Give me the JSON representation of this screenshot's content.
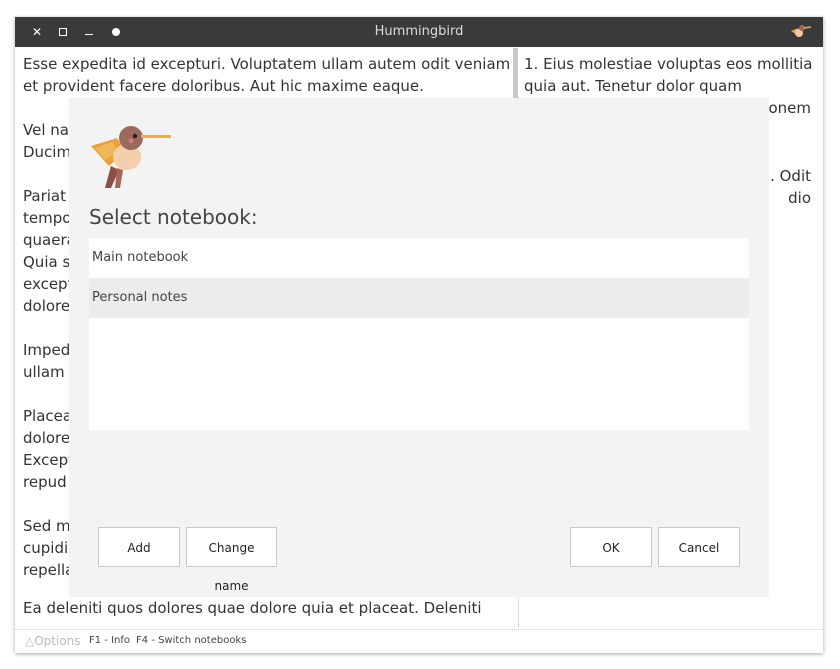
{
  "window": {
    "title": "Hummingbird",
    "controls": [
      "close-icon",
      "maximize-icon",
      "minimize-icon",
      "dot-icon"
    ]
  },
  "editor": {
    "left_paragraphs": [
      "Esse expedita id excepturi. Voluptatem ullam autem odit veniam et provident facere doloribus. Aut hic maxime eaque.",
      "Vel na\nDucim",
      "Pariat\ntempo\nquaera\nQuia s\nexcept\ndolore",
      "Imped\nullam",
      "Placea\ndolore\nExcept\nrepud",
      "Sed m\ncupidi\nrepella"
    ],
    "left_bottom_line": "Ea deleniti quos dolores quae dolore quia et placeat. Deleniti",
    "right_paragraphs": [
      "1. Eius molestiae voluptas eos mollitia quia aut. Tenetur dolor quam",
      "onem",
      ". Odit\ndio"
    ]
  },
  "statusbar": {
    "options": "△Options",
    "hint_f1": "F1 - Info",
    "hint_f4": "F4 - Switch notebooks"
  },
  "dialog": {
    "logo": "hummingbird-logo",
    "title": "Select notebook:",
    "notebooks": [
      {
        "label": "Main notebook",
        "selected": false
      },
      {
        "label": "Personal notes",
        "selected": true
      }
    ],
    "buttons": {
      "add": "Add",
      "change_name": "Change name",
      "ok": "OK",
      "cancel": "Cancel"
    }
  },
  "colors": {
    "titlebar": "#3a3a3a",
    "dialog_bg": "#f3f3f3",
    "selected_row": "#ececec"
  }
}
